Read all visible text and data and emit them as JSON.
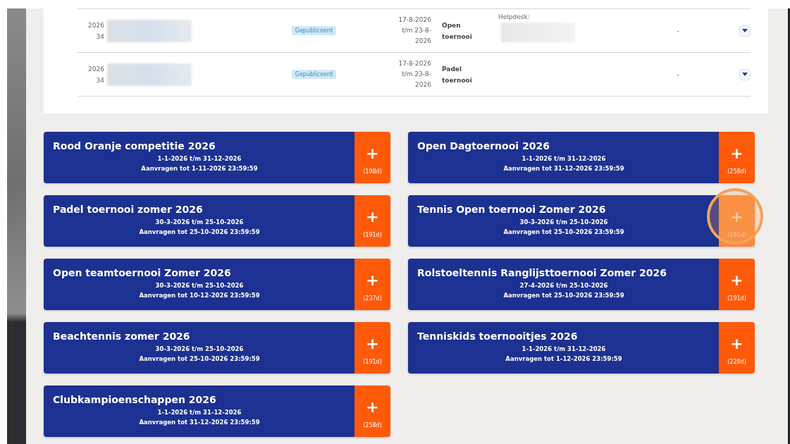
{
  "table": {
    "rows": [
      {
        "year": "2026",
        "number": "34",
        "status": "Gepubliceerd",
        "dates": [
          "17-8-2026",
          "t/m 23-8-",
          "2026"
        ],
        "type": "Open toernooi",
        "helpdesk": "Helpdesk:",
        "extra": "-"
      },
      {
        "year": "2026",
        "number": "34",
        "status": "Gepubliceerd",
        "dates": [
          "17-8-2026",
          "t/m 23-8-",
          "2026"
        ],
        "type": "Padel toernooi",
        "extra": "-"
      }
    ]
  },
  "cards": [
    {
      "title": "Rood Oranje competitie 2026",
      "period": "1-1-2026 t/m 31-12-2026",
      "deadline": "Aanvragen tot 1-11-2026 23:59:59",
      "add": "+",
      "days": "(198d)",
      "highlighted": false
    },
    {
      "title": "Open Dagtoernooi 2026",
      "period": "1-1-2026 t/m 31-12-2026",
      "deadline": "Aanvragen tot 31-12-2026 23:59:59",
      "add": "+",
      "days": "(258d)",
      "highlighted": false
    },
    {
      "title": "Padel toernooi zomer 2026",
      "period": "30-3-2026 t/m 25-10-2026",
      "deadline": "Aanvragen tot 25-10-2026 23:59:59",
      "add": "+",
      "days": "(191d)",
      "highlighted": false
    },
    {
      "title": "Tennis Open toernooi Zomer 2026",
      "period": "30-3-2026 t/m 25-10-2026",
      "deadline": "Aanvragen tot 25-10-2026 23:59:59",
      "add": "+",
      "days": "(191d)",
      "highlighted": true
    },
    {
      "title": "Open teamtoernooi Zomer 2026",
      "period": "30-3-2026 t/m 25-10-2026",
      "deadline": "Aanvragen tot 10-12-2026 23:59:59",
      "add": "+",
      "days": "(237d)",
      "highlighted": false
    },
    {
      "title": "Rolstoeltennis Ranglijsttoernooi Zomer 2026",
      "period": "27-4-2026 t/m 25-10-2026",
      "deadline": "Aanvragen tot 25-10-2026 23:59:59",
      "add": "+",
      "days": "(191d)",
      "highlighted": false
    },
    {
      "title": "Beachtennis zomer 2026",
      "period": "30-3-2026 t/m 25-10-2026",
      "deadline": "Aanvragen tot 25-10-2026 23:59:59",
      "add": "+",
      "days": "(191d)",
      "highlighted": false
    },
    {
      "title": "Tenniskids toernooitjes 2026",
      "period": "1-1-2026 t/m 31-12-2026",
      "deadline": "Aanvragen tot 1-12-2026 23:59:59",
      "add": "+",
      "days": "(228d)",
      "highlighted": false
    },
    {
      "title": "Clubkampioenschappen 2026",
      "period": "1-1-2026 t/m 31-12-2026",
      "deadline": "Aanvragen tot 31-12-2026 23:59:59",
      "add": "+",
      "days": "(258d)",
      "highlighted": false
    }
  ]
}
